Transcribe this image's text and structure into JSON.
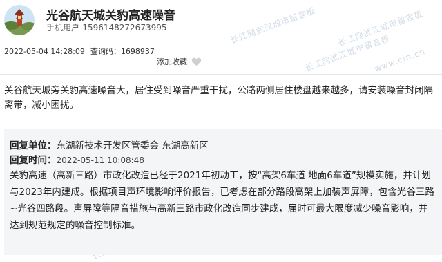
{
  "post": {
    "title": "光谷航天城关豹高速噪音",
    "user": "手机用户-1596148272673995",
    "date": "2022-05-04 14:28:09",
    "query_label": "查询码：",
    "query_code": "1698937",
    "favorite_label": "添加收藏",
    "content": "关谷航天城旁关豹高速噪音大，居住受到噪音严重干扰，公路两侧居住楼盘越来越多，请安装噪音封闭隔离带，减小困扰。"
  },
  "reply": {
    "unit_label": "回复单位：",
    "unit_value": "东湖新技术开发区管委会 东湖高新区",
    "time_label": "回复时间：",
    "time_value": "2022-05-11 10:08:48",
    "content": "关豹高速（高新三路）市政化改造已经于2021年初动工，按“高架6车道 地面6车道”规模实施，并计划与2023年内建成。根据项目声环境影响评价报告，已考虑在部分路段高架上加装声屏障，包含光谷三路~光谷四路段。声屏障等隔音措施与高新三路市政化改造同步建成，届时可最大限度减少噪音影响，并达到规范规定的噪音控制标准。"
  },
  "watermark": {
    "text": "长江网武汉城市留言板",
    "url": "www.cjn.cn"
  },
  "colors": {
    "reply_bg": "#f4f5f7",
    "watermark": "#c9d6e3"
  }
}
